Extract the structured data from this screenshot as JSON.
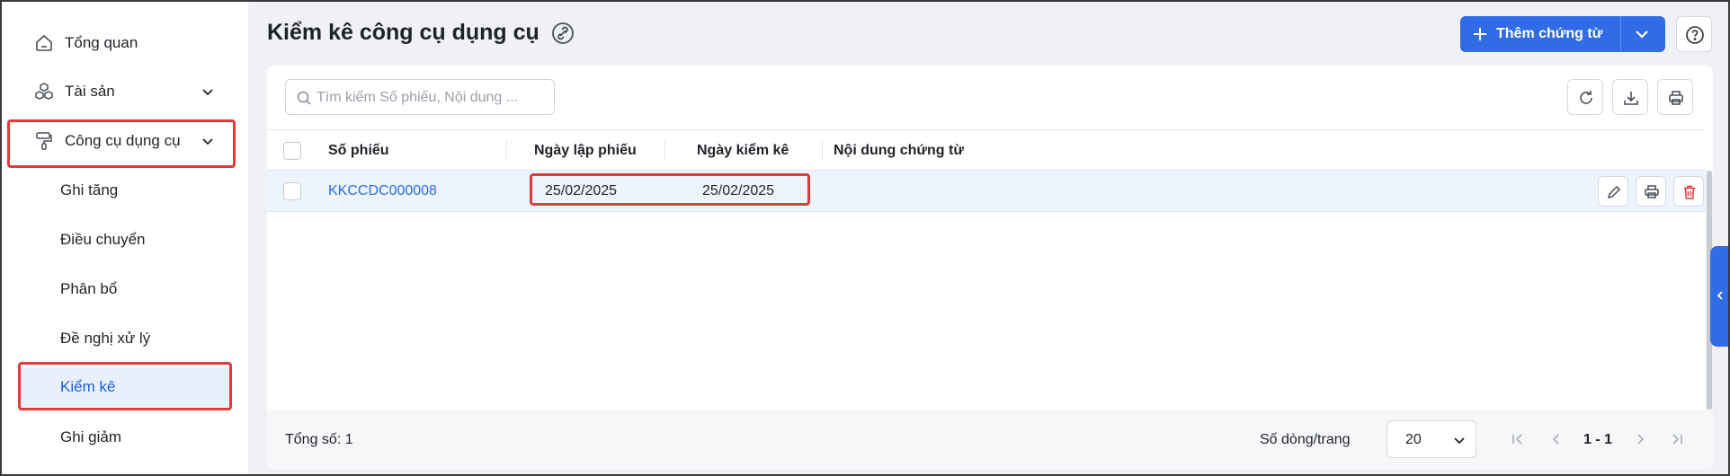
{
  "sidebar": {
    "items": [
      {
        "label": "Tổng quan",
        "icon": "home-icon"
      },
      {
        "label": "Tài sản",
        "icon": "cubes-icon"
      },
      {
        "label": "Công cụ dụng cụ",
        "icon": "paint-roller-icon"
      }
    ],
    "sub_items": [
      {
        "label": "Ghi tăng"
      },
      {
        "label": "Điều chuyển"
      },
      {
        "label": "Phân bổ"
      },
      {
        "label": "Đề nghị xử lý"
      },
      {
        "label": "Kiểm kê",
        "active": true
      },
      {
        "label": "Ghi giảm"
      }
    ]
  },
  "header": {
    "title": "Kiểm kê công cụ dụng cụ",
    "add_button_label": "Thêm chứng từ"
  },
  "search": {
    "placeholder": "Tìm kiếm Số phiếu, Nội dung ..."
  },
  "table": {
    "columns": [
      "Số phiếu",
      "Ngày lập phiếu",
      "Ngày kiểm kê",
      "Nội dung chứng từ"
    ],
    "rows": [
      {
        "so_phieu": "KKCCDC000008",
        "ngay_lap_phieu": "25/02/2025",
        "ngay_kiem_ke": "25/02/2025",
        "noi_dung": ""
      }
    ]
  },
  "footer": {
    "total_label": "Tổng số: 1",
    "rows_per_page_label": "Số dòng/trang",
    "rows_per_page_value": "20",
    "page_range": "1 - 1"
  },
  "colors": {
    "primary": "#2f6ce5",
    "highlight": "#e03a3a",
    "active_bg": "#e8f0fd"
  }
}
